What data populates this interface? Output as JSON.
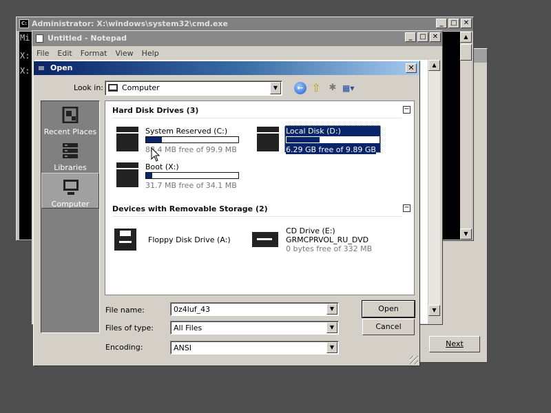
{
  "wizard": {
    "next_label": "Next"
  },
  "cmd": {
    "title": "Administrator: X:\\windows\\system32\\cmd.exe",
    "lines": [
      "Mi",
      "X:",
      "X:"
    ],
    "buttons": {
      "minimize": "_",
      "maximize": "□",
      "close": "✕"
    }
  },
  "notepad": {
    "title": "Untitled - Notepad",
    "menu": [
      "File",
      "Edit",
      "Format",
      "View",
      "Help"
    ],
    "buttons": {
      "minimize": "_",
      "maximize": "□",
      "close": "✕"
    }
  },
  "open_dialog": {
    "title": "Open",
    "close": "✕",
    "look_in_label": "Look in:",
    "look_in_value": "Computer",
    "places": [
      {
        "label": "Recent Places",
        "icon": "recent-places-icon"
      },
      {
        "label": "Libraries",
        "icon": "libraries-icon"
      },
      {
        "label": "Computer",
        "icon": "computer-icon",
        "selected": true
      }
    ],
    "groups": {
      "hard_disks": {
        "title": "Hard Disk Drives (3)",
        "collapse": "−"
      },
      "removable": {
        "title": "Devices with Removable Storage (2)",
        "collapse": "−"
      }
    },
    "drives": [
      {
        "name": "System Reserved (C:)",
        "free": "88.4 MB free of 99.9 MB",
        "used_fraction": 0.17
      },
      {
        "name": "Local Disk (D:)",
        "free": "6.29 GB free of 9.89 GB",
        "used_fraction": 0.36,
        "selected": true
      },
      {
        "name": "Boot (X:)",
        "free": "31.7 MB free of 34.1 MB",
        "used_fraction": 0.07
      }
    ],
    "devices": [
      {
        "name": "Floppy Disk Drive (A:)",
        "icon": "floppy-icon"
      },
      {
        "name": "CD Drive (E:)",
        "label": "GRMCPRVOL_RU_DVD",
        "free": "0 bytes free of 332 MB",
        "icon": "cd-drive-icon"
      }
    ],
    "file_name_label": "File name:",
    "file_name_value": "0z4luf_43",
    "file_type_label": "Files of type:",
    "file_type_value": "All Files",
    "encoding_label": "Encoding:",
    "encoding_value": "ANSI",
    "open_button": "Open",
    "cancel_button": "Cancel"
  },
  "colors": {
    "selection": "#0a246a",
    "places_bg": "#808080",
    "dialog_bg": "#d4d0c8"
  }
}
